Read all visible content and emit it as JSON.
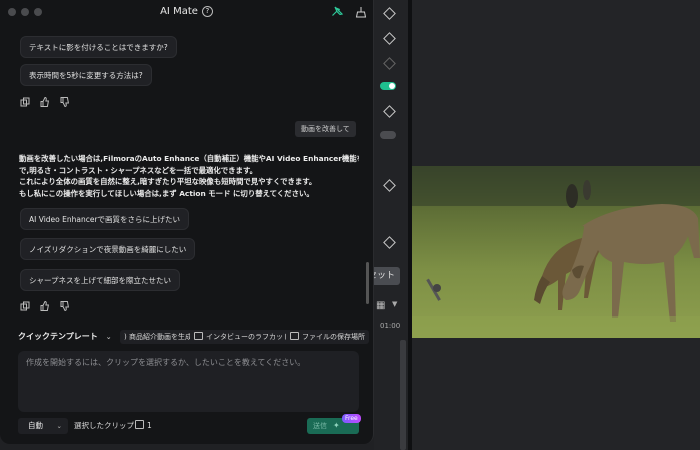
{
  "window": {
    "title": "AI Mate"
  },
  "suggestions_top": [
    "テキストに影を付けることはできますか?",
    "表示時間を5秒に変更する方法は?"
  ],
  "user_message": "動画を改善して",
  "ai_response": {
    "lines": [
      "動画を改善したい場合は,FilmoraのAuto Enhance（自動補正）機能やAI Video Enhancer機能を使うこと",
      "で,明るさ・コントラスト・シャープネスなどを一括で最適化できます。",
      "これにより全体の画質を自然に整え,暗すぎたり平坦な映像も短時間で見やすくできます。",
      "もし私にこの操作を実行してほしい場合は,まず Action モード に切り替えてください。"
    ]
  },
  "suggestions_bottom": [
    "AI Video Enhancerで画質をさらに上げたい",
    "ノイズリダクションで夜景動画を綺麗にしたい",
    "シャープネスを上げて細部を際立たせたい"
  ],
  "templates": {
    "selector_label": "クイックテンプレート",
    "chips": [
      "商品紹介動画を生成",
      "インタビューのラフカット",
      "ファイルの保存場所"
    ]
  },
  "input": {
    "placeholder": "作成を開始するには、クリップを選択するか、したいことを教えてください。",
    "value": ""
  },
  "footer": {
    "mode": "自動",
    "clip_label": "選択したクリップ",
    "clip_count": "1",
    "free_badge": "Free"
  },
  "editor": {
    "reset_label": "セット",
    "timecode": "01:00"
  },
  "colors": {
    "panel_bg": "#141517",
    "accent_green": "#1fbf8f",
    "send_button": "#1a6b55"
  }
}
